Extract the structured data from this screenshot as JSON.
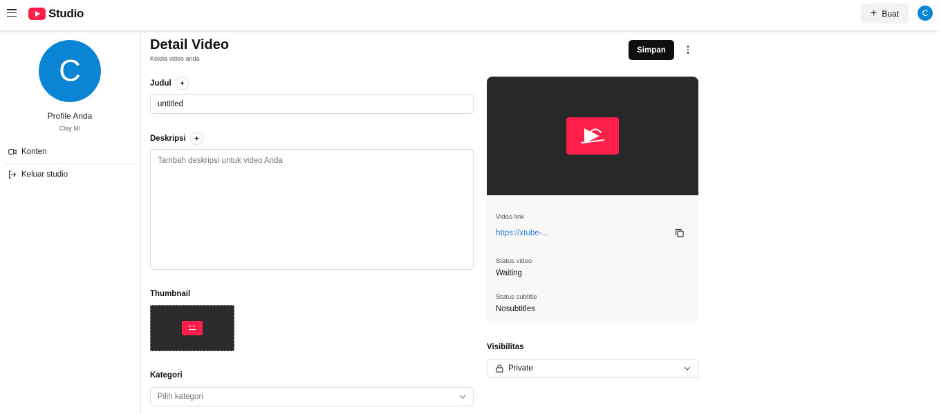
{
  "header": {
    "app_name": "Studio",
    "create_label": "Buat",
    "avatar_initial": "C"
  },
  "sidebar": {
    "avatar_initial": "C",
    "profile_name": "Profile Anda",
    "profile_sub": "Clay MI",
    "items": [
      {
        "label": "Konten",
        "icon": "video-camera-icon"
      },
      {
        "label": "Keluar studio",
        "icon": "logout-icon"
      }
    ]
  },
  "page": {
    "title": "Detail Video",
    "subtitle": "Kelola video anda",
    "save_label": "Simpan"
  },
  "form": {
    "title_label": "Judul",
    "title_value": "untitled",
    "description_label": "Deskripsi",
    "description_placeholder": "Tambah deskripsi untuk video Anda",
    "thumbnail_label": "Thumbnail",
    "category_label": "Kategori",
    "category_placeholder": "Pilih kategori"
  },
  "video": {
    "link_label": "Video link",
    "link_value": "https://xtube-...",
    "status_label": "Status video",
    "status_value": "Waiting",
    "subtitle_label": "Status subtitle",
    "subtitle_value": "Nosubtitles"
  },
  "visibility": {
    "label": "Visibilitas",
    "value": "Private"
  },
  "colors": {
    "brand": "#ff1f4b",
    "avatar": "#0a84d4",
    "link": "#2a7ad8",
    "dark": "#0f0f0f"
  }
}
